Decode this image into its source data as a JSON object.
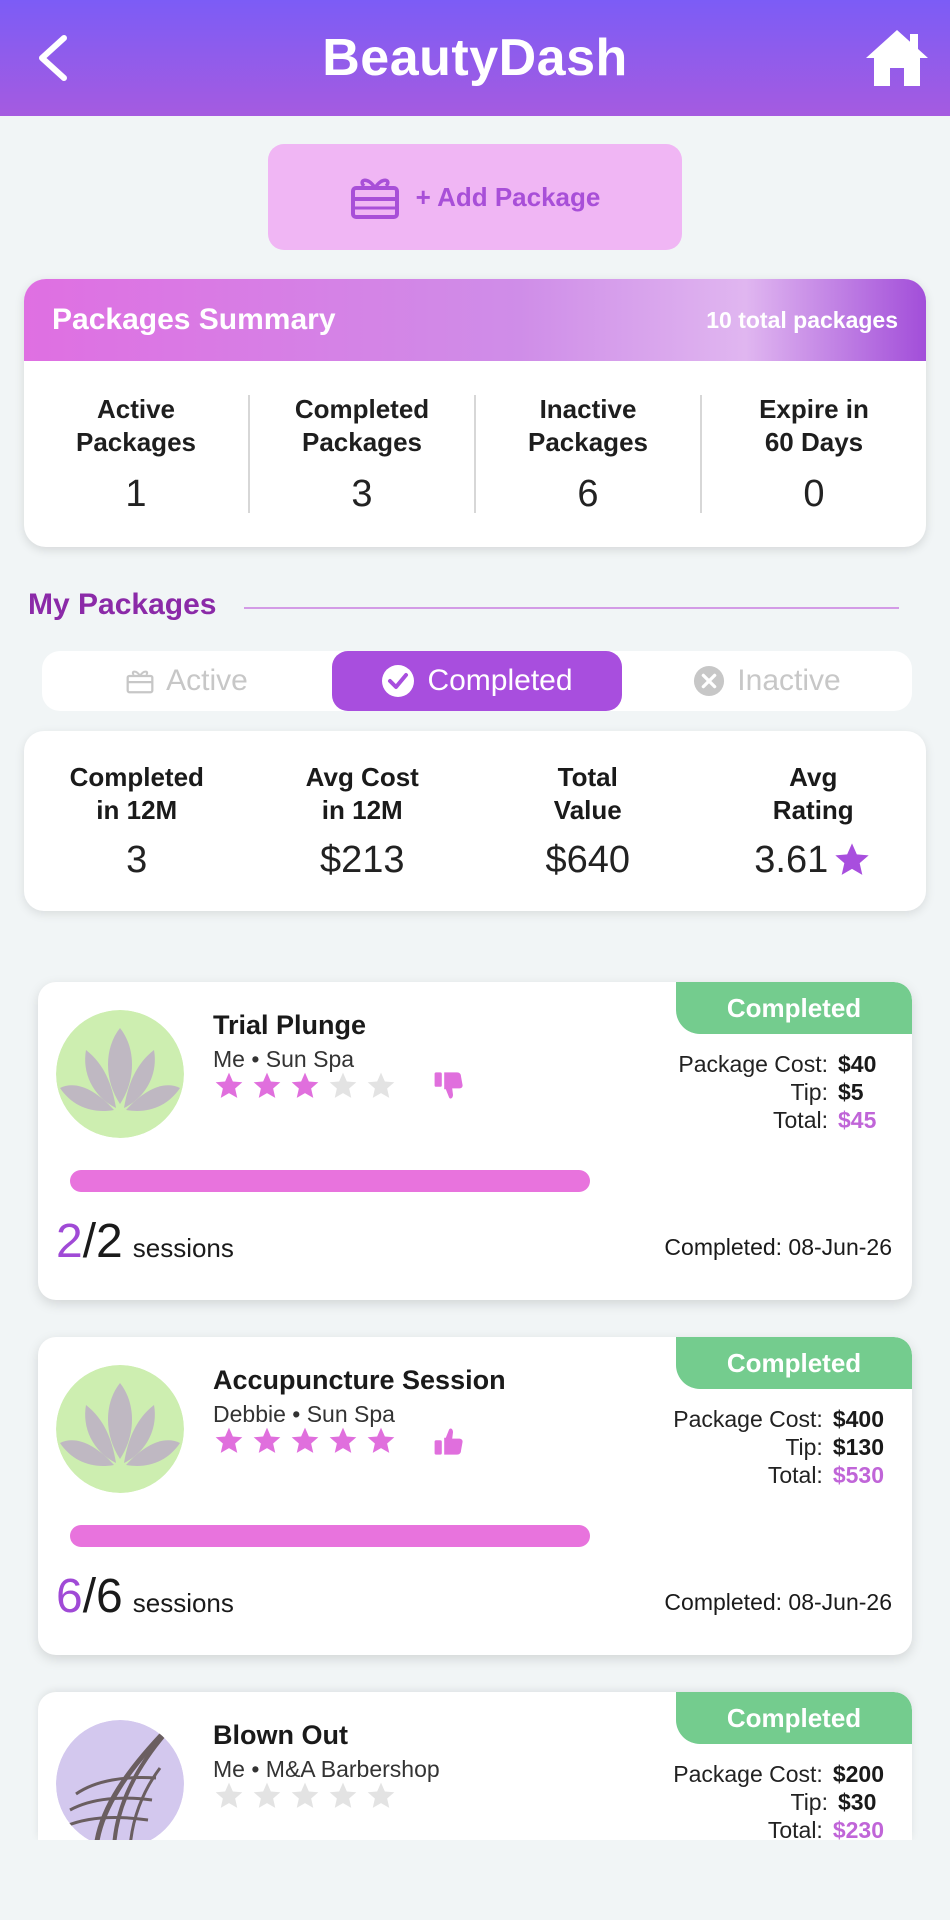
{
  "header": {
    "title": "BeautyDash"
  },
  "add_package": {
    "label": "+ Add Package"
  },
  "summary": {
    "title": "Packages Summary",
    "total": "10 total packages",
    "stats": [
      {
        "label_1": "Active",
        "label_2": "Packages",
        "value": "1"
      },
      {
        "label_1": "Completed",
        "label_2": "Packages",
        "value": "3"
      },
      {
        "label_1": "Inactive",
        "label_2": "Packages",
        "value": "6"
      },
      {
        "label_1": "Expire in",
        "label_2": "60 Days",
        "value": "0"
      }
    ]
  },
  "my_packages": {
    "title": "My Packages",
    "tabs": [
      {
        "label": "Active"
      },
      {
        "label": "Completed"
      },
      {
        "label": "Inactive"
      }
    ],
    "active_tab": "Completed"
  },
  "metrics": [
    {
      "label_1": "Completed",
      "label_2": "in 12M",
      "value": "3"
    },
    {
      "label_1": "Avg Cost",
      "label_2": "in 12M",
      "value": "$213"
    },
    {
      "label_1": "Total",
      "label_2": "Value",
      "value": "$640"
    },
    {
      "label_1": "Avg",
      "label_2": "Rating",
      "value": "3.61"
    }
  ],
  "labels": {
    "package_cost": "Package Cost:",
    "tip": "Tip:",
    "total": "Total:",
    "sessions": "sessions"
  },
  "packages": [
    {
      "name": "Trial Plunge",
      "meta": "Me • Sun Spa",
      "status": "Completed",
      "rating": 3,
      "thumb": "thumbs-down-icon",
      "cost": "$40",
      "tip": "$5",
      "total": "$45",
      "sessions_done": "2",
      "sessions_total": "/2",
      "completed": "Completed: 08-Jun-26",
      "progress": 1.0,
      "avatar": "lotus-icon"
    },
    {
      "name": "Accupuncture Session",
      "meta": "Debbie • Sun Spa",
      "status": "Completed",
      "rating": 5,
      "thumb": "thumbs-up-icon",
      "cost": "$400",
      "tip": "$130",
      "total": "$530",
      "sessions_done": "6",
      "sessions_total": "/6",
      "completed": "Completed: 08-Jun-26",
      "progress": 1.0,
      "avatar": "lotus-icon"
    },
    {
      "name": "Blown Out",
      "meta": "Me • M&A Barbershop",
      "status": "Completed",
      "rating": 0,
      "cost": "$200",
      "tip": "$30",
      "total": "$230",
      "avatar": "hair-icon"
    }
  ],
  "colors": {
    "header_start": "#7c5cf6",
    "accent": "#a84ede",
    "star_on": "#e06fdd",
    "star_off": "#e3e3e3",
    "badge": "#74cc8e"
  }
}
